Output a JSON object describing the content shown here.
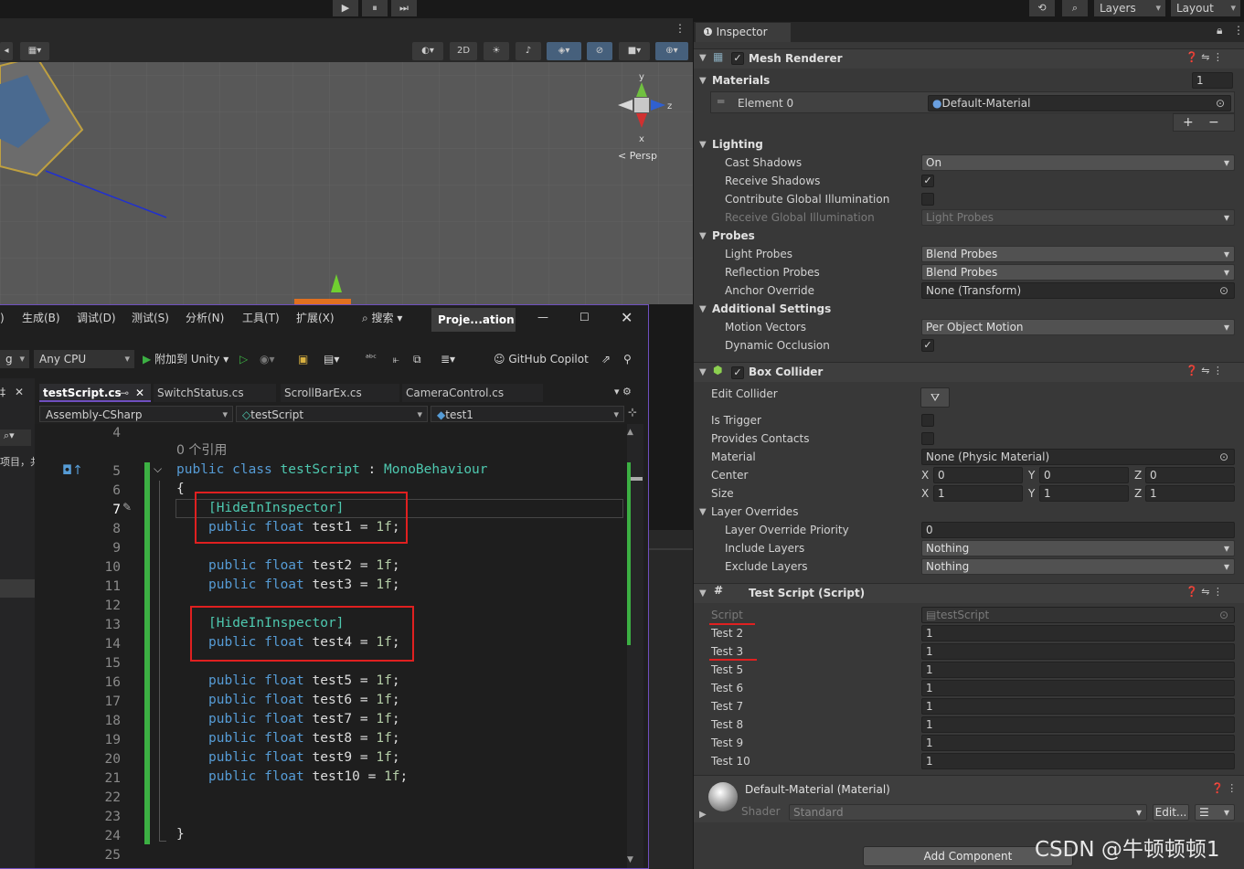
{
  "toolbar": {
    "play": "▶",
    "pause": "⏸",
    "step": "⏭",
    "layers": "Layers",
    "layout": "Layout"
  },
  "scene": {
    "gizmo_y": "y",
    "gizmo_z": "z",
    "gizmo_x": "x",
    "persp": "< Persp",
    "btn_2d": "2D"
  },
  "vs": {
    "menu": [
      ")",
      "生成(B)",
      "调试(D)",
      "测试(S)",
      "分析(N)",
      "工具(T)",
      "扩展(X)"
    ],
    "search": "搜索",
    "project": "Proje...ation",
    "cpu": "Any CPU",
    "attach": "附加到 Unity",
    "copilot": "GitHub Copilot",
    "left_dd": "g",
    "tabs": [
      "testScript.cs",
      "SwitchStatus.cs",
      "ScrollBarEx.cs",
      "CameraControl.cs"
    ],
    "nav_assembly": "Assembly-CSharp",
    "nav_class": "testScript",
    "nav_member": "test1",
    "refs": "0 个引用",
    "side_text": "项目，共",
    "line_numbers": [
      "4",
      "5",
      "6",
      "7",
      "8",
      "9",
      "10",
      "11",
      "12",
      "13",
      "14",
      "15",
      "16",
      "17",
      "18",
      "19",
      "20",
      "21",
      "22",
      "23",
      "24",
      "25"
    ],
    "code": {
      "l5": [
        "public ",
        "class ",
        "testScript",
        " : ",
        "MonoBehaviour"
      ],
      "l6": "{",
      "l7": "[HideInInspector]",
      "l8": [
        "public ",
        "float ",
        "test1 = ",
        "1f",
        ";"
      ],
      "l10": [
        "public ",
        "float ",
        "test2 = ",
        "1f",
        ";"
      ],
      "l11": [
        "public ",
        "float ",
        "test3 = ",
        "1f",
        ";"
      ],
      "l13": "[HideInInspector]",
      "l14": [
        "public ",
        "float ",
        "test4 = ",
        "1f",
        ";"
      ],
      "l16": [
        "public ",
        "float ",
        "test5 = ",
        "1f",
        ";"
      ],
      "l17": [
        "public ",
        "float ",
        "test6 = ",
        "1f",
        ";"
      ],
      "l18": [
        "public ",
        "float ",
        "test7 = ",
        "1f",
        ";"
      ],
      "l19": [
        "public ",
        "float ",
        "test8 = ",
        "1f",
        ";"
      ],
      "l20": [
        "public ",
        "float ",
        "test9 = ",
        "1f",
        ";"
      ],
      "l21": [
        "public ",
        "float ",
        "test10 = ",
        "1f",
        ";"
      ],
      "l24": "}"
    }
  },
  "inspector": {
    "tab": "Inspector",
    "mesh_renderer": {
      "title": "Mesh Renderer",
      "materials": "Materials",
      "materials_count": "1",
      "element0": "Element 0",
      "element0_value": "Default-Material",
      "lighting": "Lighting",
      "cast_shadows": "Cast Shadows",
      "cast_shadows_value": "On",
      "receive_shadows": "Receive Shadows",
      "contribute_gi": "Contribute Global Illumination",
      "receive_gi": "Receive Global Illumination",
      "receive_gi_value": "Light Probes",
      "probes": "Probes",
      "light_probes": "Light Probes",
      "light_probes_value": "Blend Probes",
      "reflection_probes": "Reflection Probes",
      "reflection_probes_value": "Blend Probes",
      "anchor_override": "Anchor Override",
      "anchor_override_value": "None (Transform)",
      "additional": "Additional Settings",
      "motion_vectors": "Motion Vectors",
      "motion_vectors_value": "Per Object Motion",
      "dynamic_occlusion": "Dynamic Occlusion"
    },
    "box_collider": {
      "title": "Box Collider",
      "edit_collider": "Edit Collider",
      "is_trigger": "Is Trigger",
      "provides_contacts": "Provides Contacts",
      "material": "Material",
      "material_value": "None (Physic Material)",
      "center": "Center",
      "size": "Size",
      "x": "X",
      "y": "Y",
      "z": "Z",
      "center_values": [
        "0",
        "0",
        "0"
      ],
      "size_values": [
        "1",
        "1",
        "1"
      ],
      "layer_overrides": "Layer Overrides",
      "layer_priority": "Layer Override Priority",
      "layer_priority_value": "0",
      "include_layers": "Include Layers",
      "include_layers_value": "Nothing",
      "exclude_layers": "Exclude Layers",
      "exclude_layers_value": "Nothing"
    },
    "test_script": {
      "title": "Test Script (Script)",
      "script": "Script",
      "script_value": "testScript",
      "fields": [
        {
          "label": "Test 2",
          "value": "1"
        },
        {
          "label": "Test 3",
          "value": "1"
        },
        {
          "label": "Test 5",
          "value": "1"
        },
        {
          "label": "Test 6",
          "value": "1"
        },
        {
          "label": "Test 7",
          "value": "1"
        },
        {
          "label": "Test 8",
          "value": "1"
        },
        {
          "label": "Test 9",
          "value": "1"
        },
        {
          "label": "Test 10",
          "value": "1"
        }
      ]
    },
    "material": {
      "title": "Default-Material (Material)",
      "shader": "Shader",
      "shader_value": "Standard",
      "edit": "Edit..."
    },
    "add_component": "Add Component"
  },
  "watermark": "CSDN @牛顿顿顿1",
  "colors": {
    "accent": "#6f4fbf",
    "keyword": "#569cd6",
    "type": "#4ec9b0",
    "number": "#b5cea8",
    "highlight": "#e02020"
  }
}
